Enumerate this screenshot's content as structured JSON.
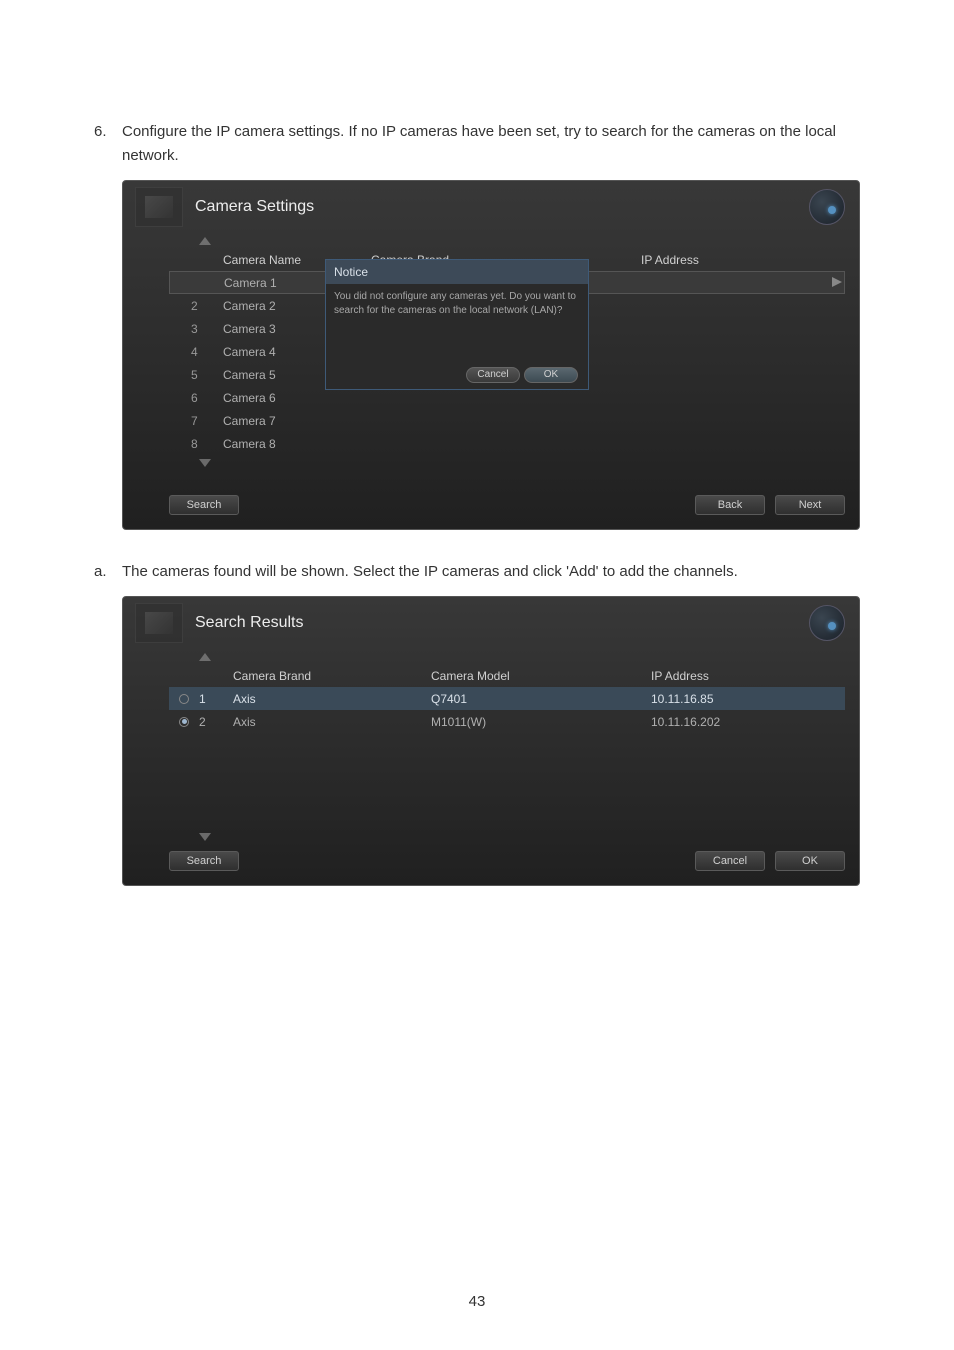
{
  "instructions": {
    "step6_num": "6.",
    "step6_text": "Configure the IP camera settings.   If no IP cameras have been set, try to search for the cameras on the local network.",
    "step_a_num": "a.",
    "step_a_text": "The cameras found will be shown.   Select the IP cameras and click 'Add' to add the channels."
  },
  "screenshot1": {
    "title": "Camera Settings",
    "headers": {
      "name": "Camera Name",
      "brand": "Camera Brand",
      "ip": "IP Address"
    },
    "rows": [
      {
        "num": "",
        "name": "Camera 1",
        "selected": true
      },
      {
        "num": "2",
        "name": "Camera 2"
      },
      {
        "num": "3",
        "name": "Camera 3"
      },
      {
        "num": "4",
        "name": "Camera 4"
      },
      {
        "num": "5",
        "name": "Camera 5"
      },
      {
        "num": "6",
        "name": "Camera 6"
      },
      {
        "num": "7",
        "name": "Camera 7"
      },
      {
        "num": "8",
        "name": "Camera 8"
      }
    ],
    "dialog": {
      "title": "Notice",
      "body": "You did not configure any cameras yet. Do you want to search for the cameras on the local network (LAN)?",
      "cancel": "Cancel",
      "ok": "OK"
    },
    "search": "Search",
    "back": "Back",
    "next": "Next"
  },
  "screenshot2": {
    "title": "Search Results",
    "headers": {
      "brand": "Camera Brand",
      "model": "Camera Model",
      "ip": "IP Address"
    },
    "rows": [
      {
        "num": "1",
        "brand": "Axis",
        "model": "Q7401",
        "ip": "10.11.16.85",
        "selected": true
      },
      {
        "num": "2",
        "brand": "Axis",
        "model": "M1011(W)",
        "ip": "10.11.16.202",
        "selected": false,
        "checked": true
      }
    ],
    "search": "Search",
    "cancel": "Cancel",
    "ok": "OK"
  },
  "page_number": "43"
}
